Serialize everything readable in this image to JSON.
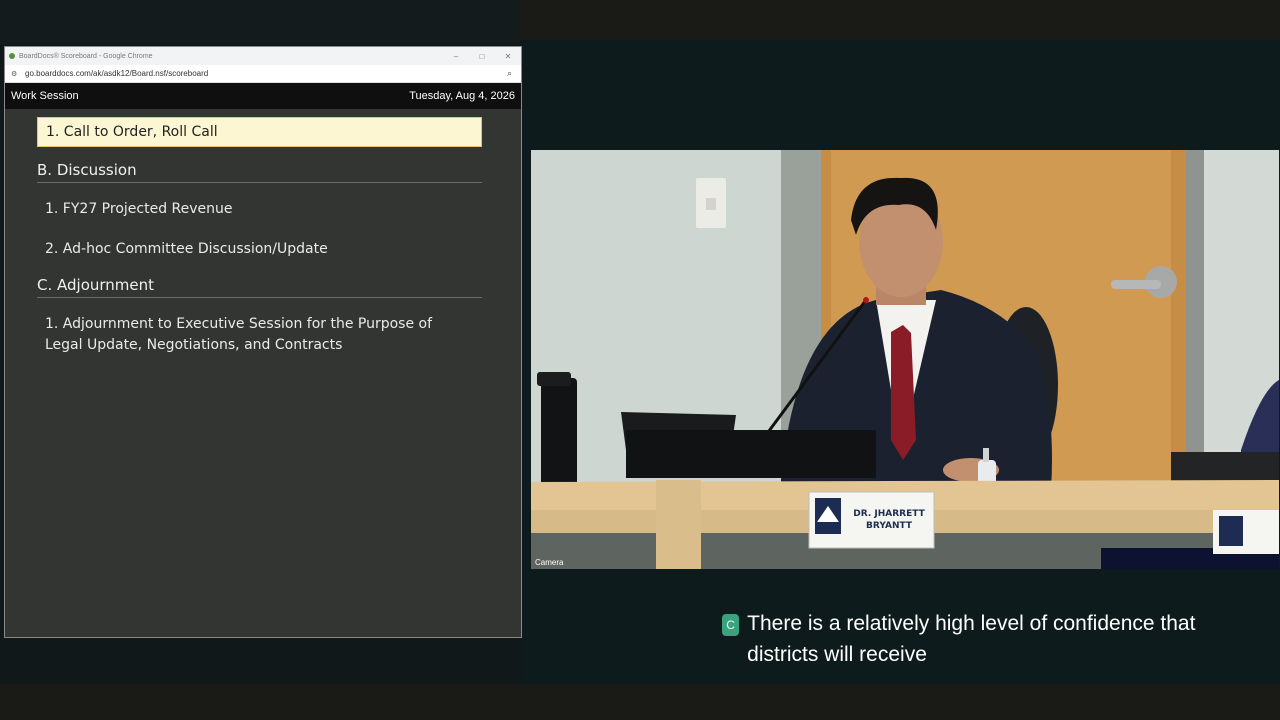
{
  "browser": {
    "window_title": "BoardDocs® Scoreboard - Google Chrome",
    "url": "go.boarddocs.com/ak/asdk12/Board.nsf/scoreboard",
    "controls": {
      "minimize": "–",
      "maximize": "□",
      "close": "✕"
    }
  },
  "header": {
    "meeting_type": "Work Session",
    "date": "Tuesday, Aug 4, 2026"
  },
  "agenda": {
    "current_item": "1. Call to Order, Roll Call",
    "sections": [
      {
        "title": "B. Discussion",
        "items": [
          "1. FY27 Projected Revenue",
          "2. Ad-hoc Committee Discussion/Update"
        ]
      },
      {
        "title": "C. Adjournment",
        "items": [
          "1. Adjournment to Executive Session for the Purpose of Legal Update, Negotiations, and Contracts"
        ]
      }
    ]
  },
  "video": {
    "label": "Camera",
    "nameplate_line1": "DR. JHARRETT",
    "nameplate_line2": "BRYANTT"
  },
  "caption": {
    "badge": "C",
    "text": "There is a relatively high level of confidence that districts will receive"
  }
}
